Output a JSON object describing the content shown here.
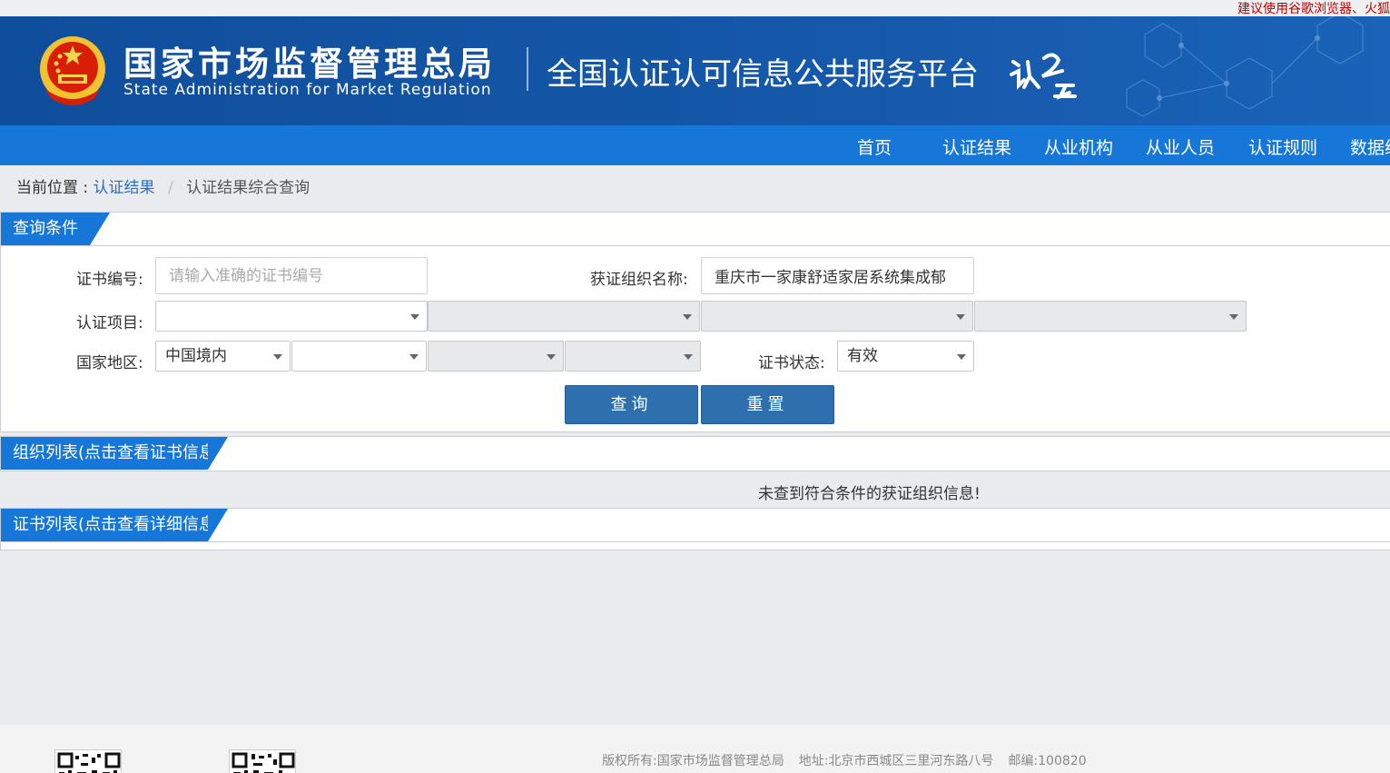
{
  "notice": "建议使用谷歌浏览器、火狐",
  "header": {
    "org_cn": "国家市场监督管理总局",
    "org_en": "State Administration  for  Market Regulation",
    "platform": "全国认证认可信息公共服务平台"
  },
  "nav": {
    "items": [
      {
        "label": "首页"
      },
      {
        "label": "认证结果"
      },
      {
        "label": "从业机构"
      },
      {
        "label": "从业人员"
      },
      {
        "label": "认证规则"
      },
      {
        "label": "数据统"
      }
    ]
  },
  "breadcrumb": {
    "prefix": "当前位置 :",
    "link": "认证结果",
    "sep": "/",
    "current": "认证结果综合查询"
  },
  "query_panel": {
    "title": "查询条件",
    "cert_no_label": "证书编号:",
    "cert_no_placeholder": "请输入准确的证书编号",
    "org_name_label": "获证组织名称:",
    "org_name_value": "重庆市一家康舒适家居系统集成郁",
    "project_label": "认证项目:",
    "region_label": "国家地区:",
    "region_value": "中国境内",
    "status_label": "证书状态:",
    "status_value": "有效",
    "search_button": "查询",
    "reset_button": "重置"
  },
  "org_panel": {
    "title": "组织列表(点击查看证书信息)",
    "empty_message": "未查到符合条件的获证组织信息!"
  },
  "cert_panel": {
    "title": "证书列表(点击查看详细信息)"
  },
  "footer": {
    "copyright": "版权所有:国家市场监督管理总局",
    "address": "地址:北京市西城区三里河东路八号",
    "postcode": "邮编:100820"
  }
}
